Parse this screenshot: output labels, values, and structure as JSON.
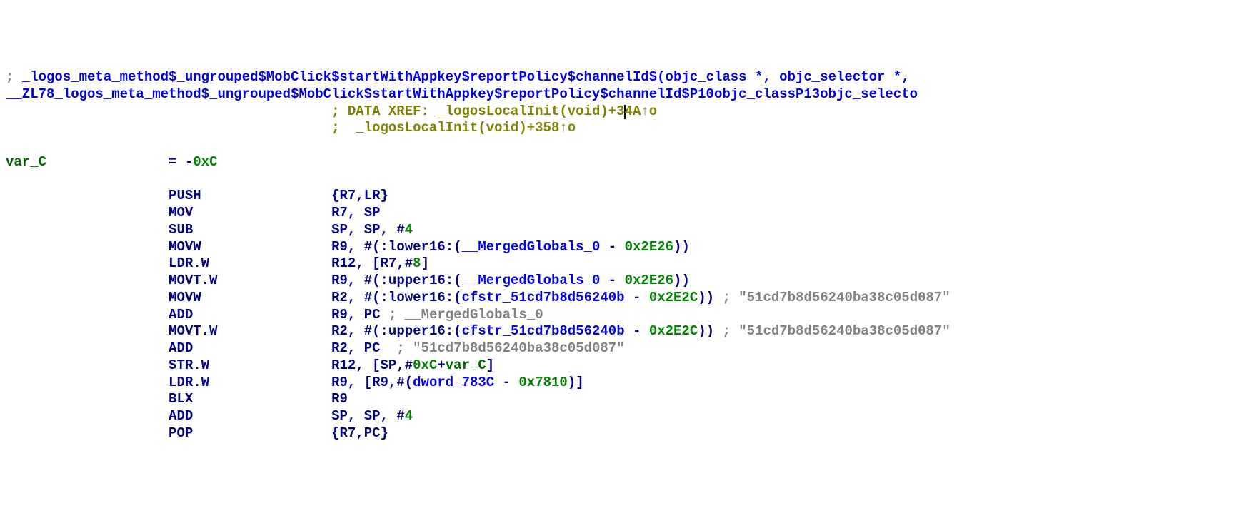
{
  "header": {
    "comment1_prefix": "; ",
    "comment1_text": "_logos_meta_method$_ungrouped$MobClick$startWithAppkey$reportPolicy$channelId$(objc_class *, objc_selector *,",
    "comment2_text": "__ZL78_logos_meta_method$_ungrouped$MobClick$startWithAppkey$reportPolicy$channelId$P10objc_classP13objc_selecto"
  },
  "xref": {
    "prefix": "; ",
    "label": "DATA XREF: ",
    "ref1_a": "_logosLocalInit(void)+3",
    "ref1_b": "4A",
    "ref1_suffix": "↑o",
    "spacer": ";  ",
    "ref2": "_logosLocalInit(void)+358",
    "ref2_suffix": "↑o"
  },
  "var": {
    "name": "var_C",
    "eq": "= ",
    "neg": "-",
    "val": "0xC"
  },
  "instructions": [
    {
      "mnemonic": "PUSH",
      "operands": [
        {
          "t": "navy",
          "s": "{"
        },
        {
          "t": "navy",
          "s": "R7"
        },
        {
          "t": "navy",
          "s": ","
        },
        {
          "t": "navy",
          "s": "LR"
        },
        {
          "t": "navy",
          "s": "}"
        }
      ]
    },
    {
      "mnemonic": "MOV",
      "operands": [
        {
          "t": "navy",
          "s": "R7"
        },
        {
          "t": "navy",
          "s": ", "
        },
        {
          "t": "navy",
          "s": "SP"
        }
      ]
    },
    {
      "mnemonic": "SUB",
      "operands": [
        {
          "t": "navy",
          "s": "SP"
        },
        {
          "t": "navy",
          "s": ", "
        },
        {
          "t": "navy",
          "s": "SP"
        },
        {
          "t": "navy",
          "s": ", "
        },
        {
          "t": "navy",
          "s": "#"
        },
        {
          "t": "green",
          "s": "4"
        }
      ]
    },
    {
      "mnemonic": "MOVW",
      "operands": [
        {
          "t": "navy",
          "s": "R9"
        },
        {
          "t": "navy",
          "s": ", #("
        },
        {
          "t": "navy",
          "s": ":lower16:"
        },
        {
          "t": "navy",
          "s": "("
        },
        {
          "t": "blue",
          "s": "__MergedGlobals_0"
        },
        {
          "t": "navy",
          "s": " - "
        },
        {
          "t": "green",
          "s": "0x2E26"
        },
        {
          "t": "navy",
          "s": "))"
        }
      ]
    },
    {
      "mnemonic": "LDR.W",
      "operands": [
        {
          "t": "navy",
          "s": "R12"
        },
        {
          "t": "navy",
          "s": ", ["
        },
        {
          "t": "navy",
          "s": "R7"
        },
        {
          "t": "navy",
          "s": ",#"
        },
        {
          "t": "green",
          "s": "8"
        },
        {
          "t": "navy",
          "s": "]"
        }
      ]
    },
    {
      "mnemonic": "MOVT.W",
      "operands": [
        {
          "t": "navy",
          "s": "R9"
        },
        {
          "t": "navy",
          "s": ", #("
        },
        {
          "t": "navy",
          "s": ":upper16:"
        },
        {
          "t": "navy",
          "s": "("
        },
        {
          "t": "blue",
          "s": "__MergedGlobals_0"
        },
        {
          "t": "navy",
          "s": " - "
        },
        {
          "t": "green",
          "s": "0x2E26"
        },
        {
          "t": "navy",
          "s": "))"
        }
      ]
    },
    {
      "mnemonic": "MOVW",
      "operands": [
        {
          "t": "navy",
          "s": "R2"
        },
        {
          "t": "navy",
          "s": ", #("
        },
        {
          "t": "navy",
          "s": ":lower16:"
        },
        {
          "t": "navy",
          "s": "("
        },
        {
          "t": "blue",
          "s": "cfstr_51cd7b8d56240b"
        },
        {
          "t": "navy",
          "s": " - "
        },
        {
          "t": "green",
          "s": "0x2E2C"
        },
        {
          "t": "navy",
          "s": "))"
        }
      ],
      "tail": [
        {
          "t": "gray",
          "s": " ; \"51cd7b8d56240ba38c05d087\""
        }
      ]
    },
    {
      "mnemonic": "ADD",
      "operands": [
        {
          "t": "navy",
          "s": "R9"
        },
        {
          "t": "navy",
          "s": ", "
        },
        {
          "t": "navy",
          "s": "PC"
        }
      ],
      "tail": [
        {
          "t": "gray",
          "s": " ; "
        },
        {
          "t": "gray",
          "s": "__MergedGlobals_0"
        }
      ]
    },
    {
      "mnemonic": "MOVT.W",
      "operands": [
        {
          "t": "navy",
          "s": "R2"
        },
        {
          "t": "navy",
          "s": ", #("
        },
        {
          "t": "navy",
          "s": ":upper16:"
        },
        {
          "t": "navy",
          "s": "("
        },
        {
          "t": "blue",
          "s": "cfstr_51cd7b8d56240b"
        },
        {
          "t": "navy",
          "s": " - "
        },
        {
          "t": "green",
          "s": "0x2E2C"
        },
        {
          "t": "navy",
          "s": "))"
        }
      ],
      "tail": [
        {
          "t": "gray",
          "s": " ; \"51cd7b8d56240ba38c05d087\""
        }
      ]
    },
    {
      "mnemonic": "ADD",
      "operands": [
        {
          "t": "navy",
          "s": "R2"
        },
        {
          "t": "navy",
          "s": ", "
        },
        {
          "t": "navy",
          "s": "PC"
        }
      ],
      "tail": [
        {
          "t": "gray",
          "s": "  ; \"51cd7b8d56240ba38c05d087\""
        }
      ]
    },
    {
      "mnemonic": "STR.W",
      "operands": [
        {
          "t": "navy",
          "s": "R12"
        },
        {
          "t": "navy",
          "s": ", ["
        },
        {
          "t": "navy",
          "s": "SP"
        },
        {
          "t": "navy",
          "s": ",#"
        },
        {
          "t": "green",
          "s": "0xC"
        },
        {
          "t": "navy",
          "s": "+"
        },
        {
          "t": "darkgreen",
          "s": "var_C"
        },
        {
          "t": "navy",
          "s": "]"
        }
      ]
    },
    {
      "mnemonic": "LDR.W",
      "operands": [
        {
          "t": "navy",
          "s": "R9"
        },
        {
          "t": "navy",
          "s": ", ["
        },
        {
          "t": "navy",
          "s": "R9"
        },
        {
          "t": "navy",
          "s": ",#("
        },
        {
          "t": "blue",
          "s": "dword_783C"
        },
        {
          "t": "navy",
          "s": " - "
        },
        {
          "t": "green",
          "s": "0x7810"
        },
        {
          "t": "navy",
          "s": ")]"
        }
      ]
    },
    {
      "mnemonic": "BLX",
      "operands": [
        {
          "t": "navy",
          "s": "R9"
        }
      ]
    },
    {
      "mnemonic": "ADD",
      "operands": [
        {
          "t": "navy",
          "s": "SP"
        },
        {
          "t": "navy",
          "s": ", "
        },
        {
          "t": "navy",
          "s": "SP"
        },
        {
          "t": "navy",
          "s": ", "
        },
        {
          "t": "navy",
          "s": "#"
        },
        {
          "t": "green",
          "s": "4"
        }
      ]
    },
    {
      "mnemonic": "POP",
      "operands": [
        {
          "t": "navy",
          "s": "{"
        },
        {
          "t": "navy",
          "s": "R7"
        },
        {
          "t": "navy",
          "s": ","
        },
        {
          "t": "navy",
          "s": "PC"
        },
        {
          "t": "navy",
          "s": "}"
        }
      ]
    }
  ],
  "layout": {
    "mnemonic_col": 20,
    "operand_col": 40,
    "xref_col": 40
  }
}
